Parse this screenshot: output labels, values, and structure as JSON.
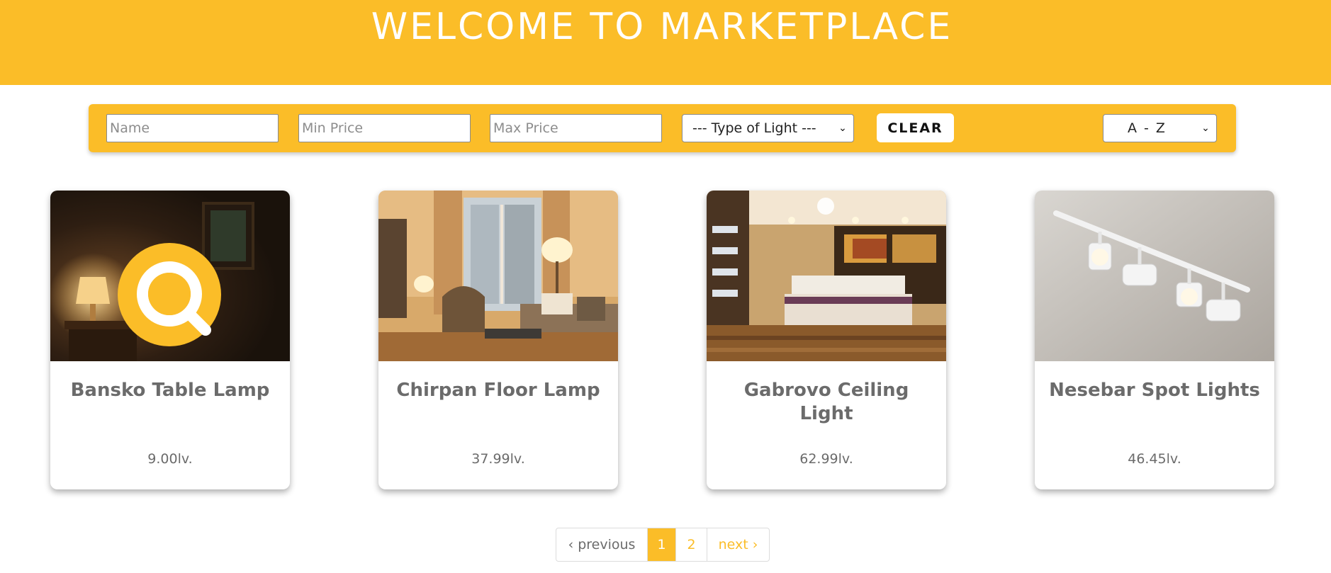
{
  "header": {
    "title": "WELCOME TO MARKETPLACE"
  },
  "filters": {
    "name_placeholder": "Name",
    "min_price_placeholder": "Min Price",
    "max_price_placeholder": "Max Price",
    "type_select": {
      "selected": "--- Type of Light ---"
    },
    "clear_label": "CLEAR",
    "sort_select": {
      "selected": "A - Z"
    }
  },
  "products": [
    {
      "name": "Bansko Table Lamp",
      "price": "9.00lv.",
      "image_icon": "search-icon"
    },
    {
      "name": "Chirpan Floor Lamp",
      "price": "37.99lv."
    },
    {
      "name": "Gabrovo Ceiling Light",
      "price": "62.99lv."
    },
    {
      "name": "Nesebar Spot Lights",
      "price": "46.45lv."
    }
  ],
  "pagination": {
    "previous": "‹ previous",
    "pages": [
      "1",
      "2"
    ],
    "current": "1",
    "next": "next ›"
  },
  "colors": {
    "accent": "#fbbd28",
    "text_gray": "#6b6b6b"
  }
}
